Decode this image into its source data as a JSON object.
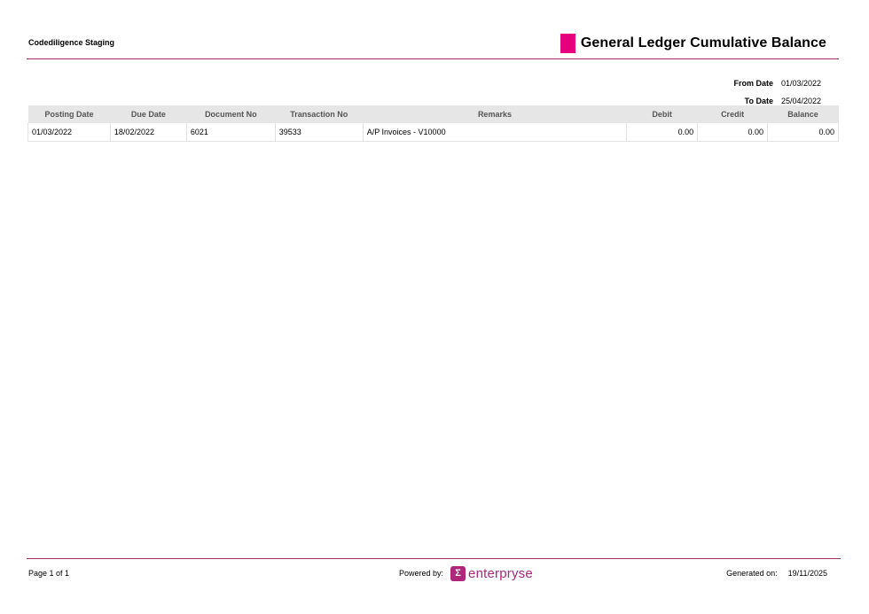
{
  "header": {
    "company": "Codediligence Staging",
    "title": "General Ledger Cumulative Balance",
    "accent_color": "#e6007e"
  },
  "filters": {
    "from_label": "From Date",
    "from_value": "01/03/2022",
    "to_label": "To Date",
    "to_value": "25/04/2022"
  },
  "table": {
    "columns": [
      "Posting Date",
      "Due Date",
      "Document No",
      "Transaction No",
      "Remarks",
      "Debit",
      "Credit",
      "Balance"
    ],
    "rows": [
      [
        "01/03/2022",
        "18/02/2022",
        "6021",
        "39533",
        "A/P Invoices - V10000",
        "0.00",
        "0.00",
        "0.00"
      ]
    ]
  },
  "footer": {
    "page": "Page 1 of 1",
    "powered_label": "Powered by:",
    "logo_icon": "sigma-logo-icon",
    "logo_glyph": "Σ",
    "logo_text": "enterpryse",
    "generated_label": "Generated on:",
    "generated_value": "19/11/2025"
  }
}
